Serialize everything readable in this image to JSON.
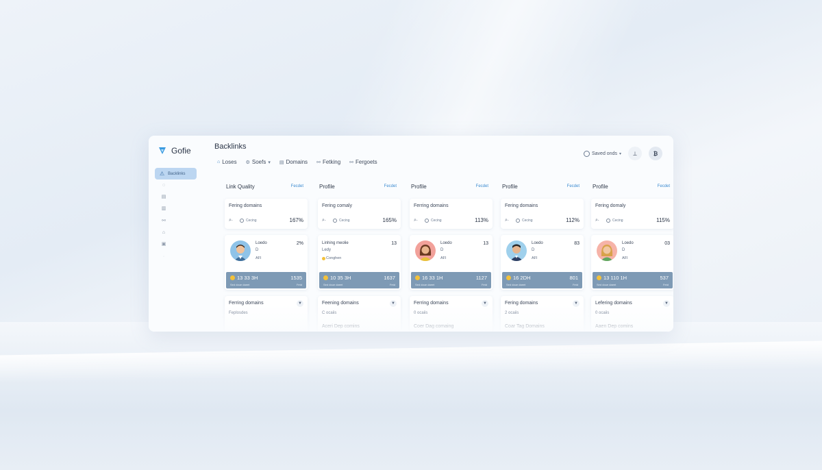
{
  "app": {
    "brand": "Gofie",
    "title": "Backlinks"
  },
  "colors": {
    "accent": "#3b82c4",
    "sidebar_active": "#bcd6f1",
    "stat_bar": "#7e9ab5",
    "coin": "#f3c13a"
  },
  "sidebar": {
    "active_label": "Backlinks",
    "items": [
      {
        "icon": "home-icon"
      },
      {
        "icon": "chat-icon"
      },
      {
        "icon": "document-icon"
      },
      {
        "icon": "chart-icon"
      },
      {
        "icon": "link-icon"
      },
      {
        "icon": "lock-icon"
      },
      {
        "icon": "briefcase-icon"
      },
      {
        "icon": "dot-icon"
      }
    ]
  },
  "tabs": [
    {
      "label": "Loses",
      "icon": "home-icon"
    },
    {
      "label": "Soefs",
      "icon": "gear-icon"
    },
    {
      "label": "Domains",
      "icon": "document-icon"
    },
    {
      "label": "Fetking",
      "icon": "link-icon"
    },
    {
      "label": "Fergoets",
      "icon": "link-icon"
    }
  ],
  "header": {
    "saved_label": "Saved onds",
    "user_btn": "⊥",
    "profile_btn": "₿"
  },
  "columns": [
    {
      "title": "Link Quality",
      "link": "Fecdet",
      "card1": {
        "heading": "Fering domains",
        "small": "Cecing",
        "pct": "167%"
      },
      "card2": {
        "name": "Loedo",
        "sub": "D",
        "sub2": "AFI",
        "num": "2%",
        "bar_main": "13 33 3H",
        "bar_right": "1535",
        "bar_tiny": "Sed doue daeet",
        "bar_tiny_r": "Fetd",
        "avatar": "man-blue"
      },
      "card3": {
        "heading": "Ferring domains",
        "line2": "Feplosdes",
        "line3": ""
      }
    },
    {
      "title": "Profile",
      "link": "Fecdet",
      "card1": {
        "heading": "Fering comaly",
        "small": "Cecing",
        "pct": "165%"
      },
      "card2": {
        "name": "Linhing meolie",
        "sub": "Ledy",
        "sub2": "Conghen",
        "num": "13",
        "bar_main": "10 35 3H",
        "bar_right": "1637",
        "bar_tiny": "Sed doue daeet",
        "bar_tiny_r": "Fetd",
        "avatar": ""
      },
      "card3": {
        "heading": "Feening domains",
        "line2": "C ocaiis",
        "line3": "Aceri Dep comins"
      }
    },
    {
      "title": "Profile",
      "link": "Fecdet",
      "card1": {
        "heading": "Ferring domains",
        "small": "Cecing",
        "pct": "113%"
      },
      "card2": {
        "name": "Loedo",
        "sub": "D",
        "sub2": "AFI",
        "num": "13",
        "bar_main": "16 33 1H",
        "bar_right": "1127",
        "bar_tiny": "Sed doue daeet",
        "bar_tiny_r": "Fetd",
        "avatar": "woman-dark"
      },
      "card3": {
        "heading": "Ferring domains",
        "line2": "0 ocaiis",
        "line3": "Coer Dag comaing"
      }
    },
    {
      "title": "Profile",
      "link": "Fecdet",
      "card1": {
        "heading": "Fering domains",
        "small": "Cecing",
        "pct": "112%"
      },
      "card2": {
        "name": "Loedo",
        "sub": "D",
        "sub2": "AFI",
        "num": "83",
        "bar_main": "16 2DH",
        "bar_right": "801",
        "bar_tiny": "Sed doue daeet",
        "bar_tiny_r": "Fetd",
        "avatar": "man-navy"
      },
      "card3": {
        "heading": "Fering domains",
        "line2": "2 ocaiis",
        "line3": "Coar Tag Domains"
      }
    },
    {
      "title": "Profile",
      "link": "Fecdet",
      "card1": {
        "heading": "Fering domaly",
        "small": "Cecing",
        "pct": "115%"
      },
      "card2": {
        "name": "Loedo",
        "sub": "D",
        "sub2": "AFI",
        "num": "03",
        "bar_main": "13 110 1H",
        "bar_right": "537",
        "bar_tiny": "Sed doue daeet",
        "bar_tiny_r": "Fetd",
        "avatar": "woman-blonde"
      },
      "card3": {
        "heading": "Lefering domains",
        "line2": "0 ocaiis",
        "line3": "Aaen Dep comins"
      }
    }
  ]
}
